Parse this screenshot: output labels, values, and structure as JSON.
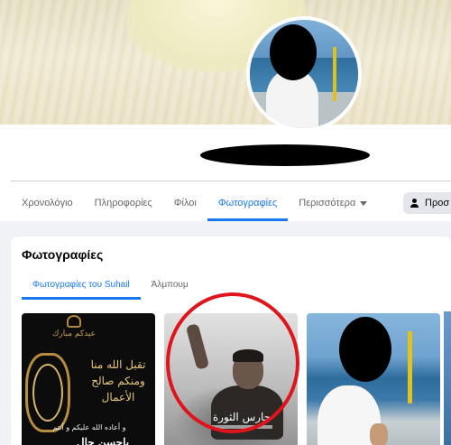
{
  "profile": {
    "cover_photo": "cover-photo",
    "avatar": "profile-picture"
  },
  "nav": {
    "tabs": [
      {
        "label": "Χρονολόγιο"
      },
      {
        "label": "Πληροφορίες"
      },
      {
        "label": "Φίλοι"
      },
      {
        "label": "Φωτογραφίες",
        "active": true
      },
      {
        "label": "Περισσότερα"
      }
    ],
    "action_button": "Προσ"
  },
  "photos": {
    "title": "Φωτογραφίες",
    "subtabs": [
      {
        "label": "Φωτογραφίες του Suhail",
        "active": true
      },
      {
        "label": "Άλμπουμ"
      }
    ],
    "items": [
      {
        "top": "عيدكم مبارك",
        "center": "تقبل الله منا ومنكم صالح الأعمال",
        "bottom": "و أعاده الله عليكم و أنتم",
        "name": "باحسن حال"
      },
      {
        "caption": "حارس الثورة"
      },
      {}
    ]
  },
  "colors": {
    "accent": "#1877f2",
    "highlight_circle": "#e0141b"
  }
}
